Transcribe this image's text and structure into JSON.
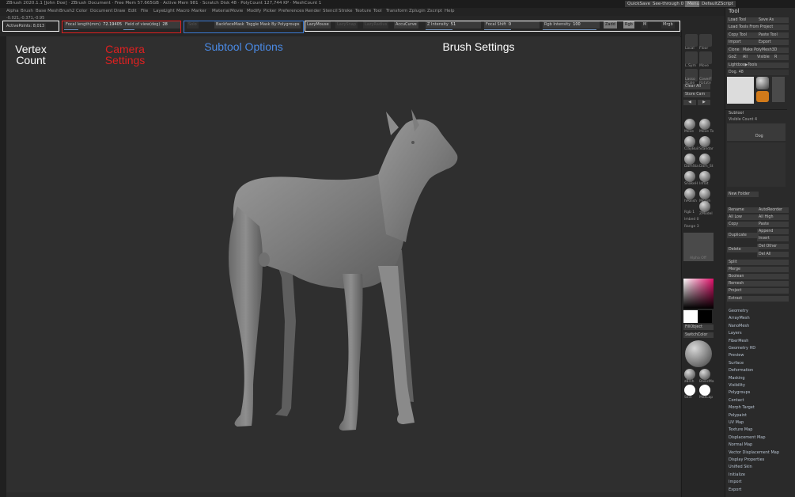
{
  "titlebar": {
    "title": "ZBrush 2020.1.1 [John Doe] · ZBrush Document · Free Mem 57.665GB · Active Mem 981 · Scratch Disk 48 · PolyCount 127,744 KP · MeshCount 1",
    "quicksave": "QuickSave",
    "seethrough": "See-through 0",
    "menus": "Menus",
    "script": "DefaultZScript"
  },
  "menubar": [
    "Alpha",
    "Brush",
    "Base Mesh",
    "Brush2",
    "Color",
    "Document",
    "Draw",
    "Edit",
    "File",
    "Layer",
    "Light",
    "Macro",
    "Marker",
    "Material",
    "Movie",
    "Modify",
    "Picker",
    "Preferences",
    "Render",
    "Stencil",
    "Stroke",
    "Texture",
    "Tool",
    "Transform",
    "Zplugin",
    "Zscript",
    "Help"
  ],
  "shelf": {
    "active_points_label": "ActivePoints: 8,013",
    "coords": "-0.021,-0.371,-0.95",
    "focal_label": "Focal length(mm)",
    "focal_value": "72.19405",
    "fov_label": "Field of view(deg)",
    "fov_value": "28",
    "subtool_dim": "Solo",
    "backface": "BackfaceMask",
    "toggle_mask": "Toggle Mask By Polygroups",
    "lazymouse": "LazyMouse",
    "lazy_dim1": "LazySnap",
    "lazy_dim2": "LazyRadius",
    "accucurve": "AccuCurve",
    "z_intensity_label": "Z Intensity",
    "z_intensity_value": "51",
    "focal_shift_label": "Focal Shift",
    "focal_shift_value": "0",
    "rgb_label": "Rgb Intensity",
    "rgb_value": "100",
    "zadd": "Zadd",
    "rgb_btn": "Rgb",
    "m_btn": "M",
    "mrgb": "Mrgb"
  },
  "annotations": {
    "vertex": "Vertex\nCount",
    "camera": "Camera\nSettings",
    "subtool": "Subtool Options",
    "brush": "Brush Settings"
  },
  "colors": {
    "vertex_box": "#ffffff",
    "camera_box": "#e02020",
    "subtool_box": "#3a7bd5",
    "brush_box": "#ffffff"
  },
  "iconcol": {
    "labels": [
      "Local",
      "Floor",
      "L.Sym",
      "Move",
      "Scale",
      "Rotate"
    ],
    "lasso": "Lasso",
    "coverf": "CoverF",
    "clear_all": "Clear All",
    "store_cam": "Store Cam",
    "brushes": [
      "Move",
      "Move To",
      "ClayBuil",
      "Standar",
      "DamSta",
      "Dam_St",
      "SnakeH",
      "Inflat",
      "hPolish",
      "Morph",
      "ZModel"
    ],
    "rgb_disp": "Rgb 1",
    "imbed": "Imbed 0",
    "range": "Range 3",
    "alpha_off": "Alpha Off",
    "fill_object": "FillObject",
    "switch_color": "SwitchColor",
    "materials": [
      "zBrsh",
      "BasicMa",
      "Skin",
      "MatCap"
    ]
  },
  "tool": {
    "header": "Tool",
    "buttons": [
      "Load Tool",
      "Save As",
      "Load Tools From Project",
      "Copy Tool",
      "Paste Tool",
      "Import",
      "Export",
      "Clone",
      "Make PolyMesh3D",
      "GoZ",
      "All",
      "Visible",
      "R"
    ],
    "lightbox": "Lightbox▶Tools",
    "dog_label": "Dog. 48",
    "thumbs": [
      "Dog",
      "Sphere3D",
      "SimpleB",
      "PM3D_Dog"
    ],
    "subtool_header": "Subtool",
    "visible_count": "Visible Count 4",
    "subtool_item": "Dog",
    "new_folder": "New Folder",
    "actions": [
      "Rename",
      "AutoReorder",
      "All Low",
      "All High",
      "Copy",
      "Paste",
      "Append",
      "Duplicate",
      "Insert",
      "Delete",
      "Del Other",
      "Del All",
      "Split",
      "Merge",
      "Boolean",
      "Remesh",
      "Project",
      "Extract"
    ],
    "sections": [
      "Geometry",
      "ArrayMesh",
      "NanoMesh",
      "Layers",
      "FiberMesh",
      "Geometry HD",
      "Preview",
      "Surface",
      "Deformation",
      "Masking",
      "Visibility",
      "Polygroups",
      "Contact",
      "Morph Target",
      "Polypaint",
      "UV Map",
      "Texture Map",
      "Displacement Map",
      "Normal Map",
      "Vector Displacement Map",
      "Display Properties",
      "Unified Skin",
      "Initialize",
      "Import",
      "Export"
    ]
  },
  "viewport_subject": "dog-sculpt"
}
